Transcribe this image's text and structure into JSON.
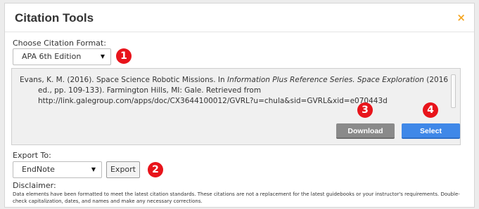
{
  "dialog": {
    "title": "Citation Tools",
    "close_symbol": "×"
  },
  "format": {
    "label": "Choose Citation Format:",
    "selected": "APA 6th Edition",
    "badge": "1"
  },
  "citation": {
    "author_year": "Evans, K. M. (2016). Space Science Robotic Missions. In ",
    "series_title": "Information Plus Reference Series. Space Exploration",
    "details": " (2016 ed., pp. 109-133). Farmington Hills, MI: Gale. Retrieved from http://link.galegroup.com/apps/doc/CX3644100012/GVRL?u=chula&sid=GVRL&xid=e070443d"
  },
  "actions": {
    "download_label": "Download",
    "download_badge": "3",
    "select_label": "Select",
    "select_badge": "4"
  },
  "export": {
    "label": "Export To:",
    "selected": "EndNote",
    "button_label": "Export",
    "badge": "2"
  },
  "disclaimer": {
    "heading": "Disclaimer:",
    "text": "Data elements have been formatted to meet the latest citation standards. These citations are not a replacement for the latest guidebooks or your instructor's requirements. Double-check capitalization, dates, and names and make any necessary corrections."
  },
  "colors": {
    "badge": "#e8141b",
    "select_button": "#3f88e8",
    "download_button": "#8a8a8a",
    "close_icon": "#f5a623"
  },
  "icons": [
    "close-icon",
    "dropdown-arrow-icon"
  ]
}
